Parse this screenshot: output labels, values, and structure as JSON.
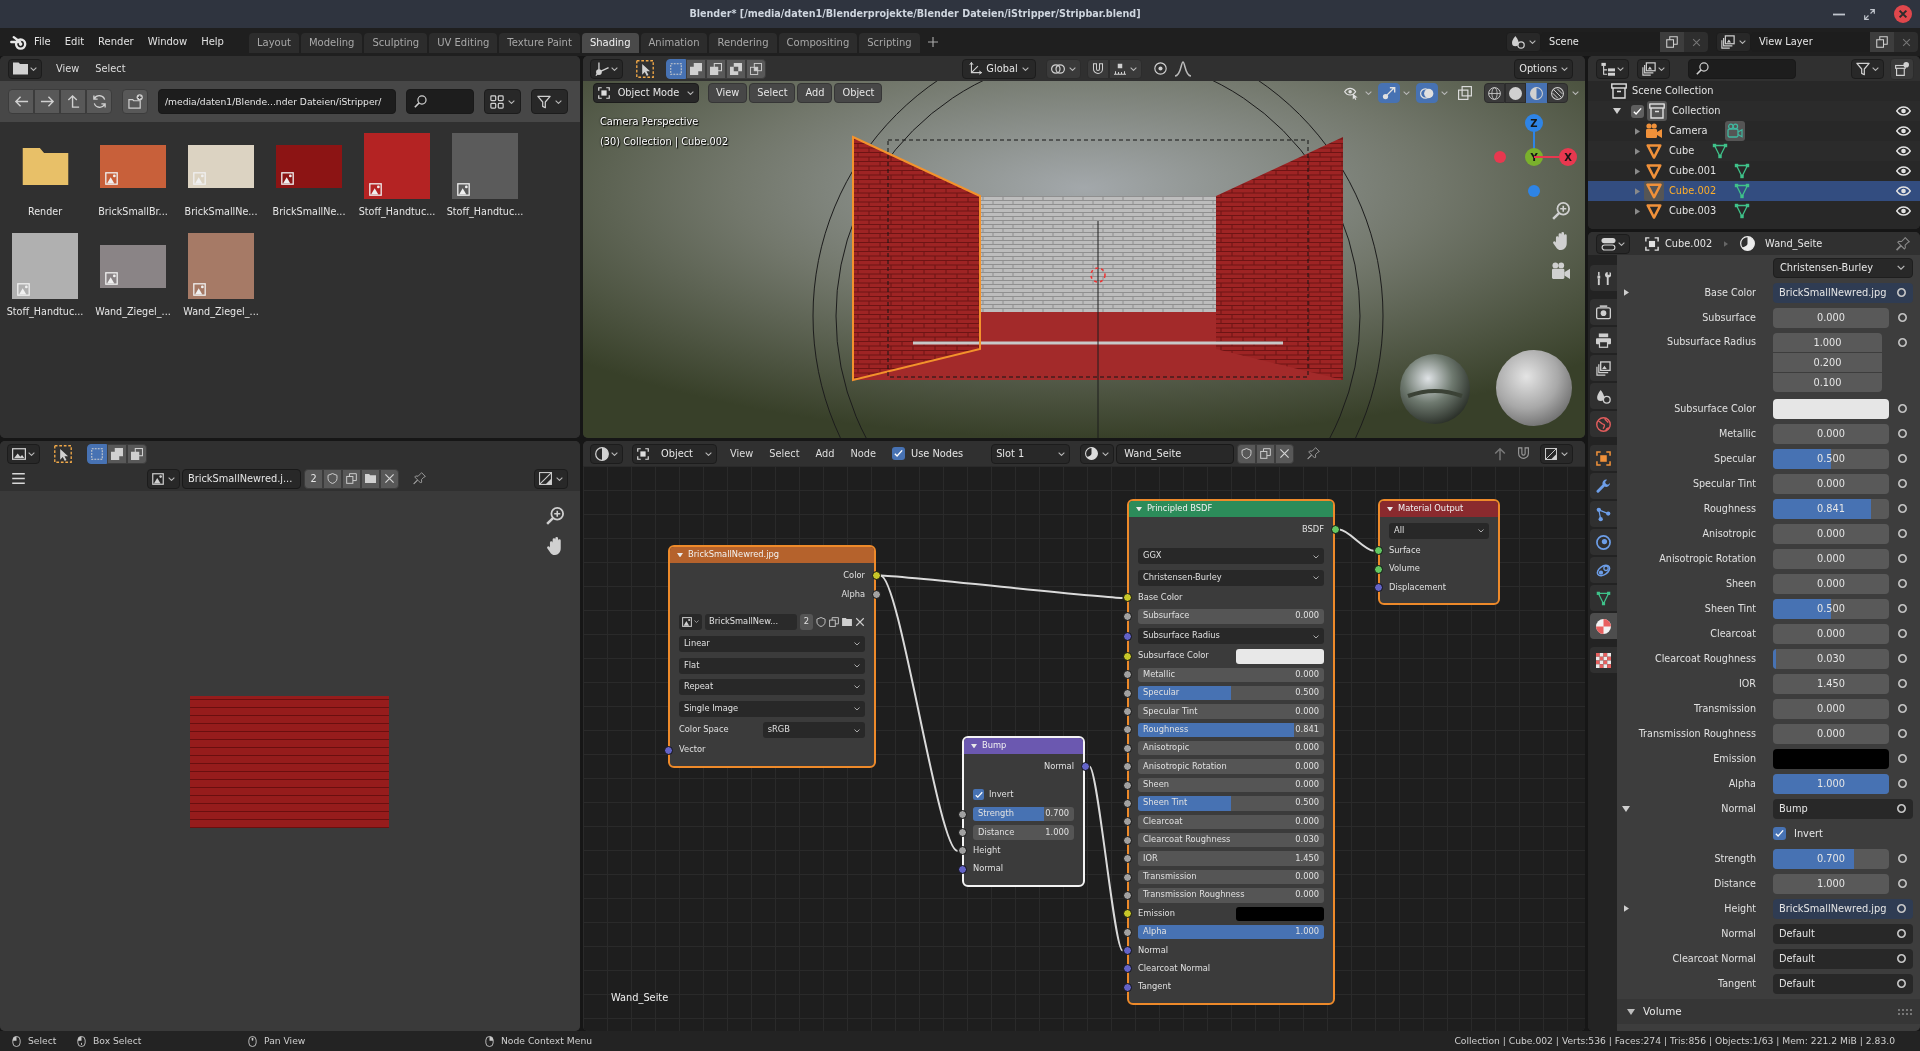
{
  "window": {
    "title": "Blender* [/media/daten1/Blenderprojekte/Blender Dateien/iStripper/Stripbar.blend]"
  },
  "menu": [
    "File",
    "Edit",
    "Render",
    "Window",
    "Help"
  ],
  "workspaces": [
    {
      "label": "Layout",
      "selected": false
    },
    {
      "label": "Modeling",
      "selected": false
    },
    {
      "label": "Sculpting",
      "selected": false
    },
    {
      "label": "UV Editing",
      "selected": false
    },
    {
      "label": "Texture Paint",
      "selected": false
    },
    {
      "label": "Shading",
      "selected": true
    },
    {
      "label": "Animation",
      "selected": false
    },
    {
      "label": "Rendering",
      "selected": false
    },
    {
      "label": "Compositing",
      "selected": false
    },
    {
      "label": "Scripting",
      "selected": false
    }
  ],
  "scene": "Scene",
  "view_layer": "View Layer",
  "file_browser": {
    "menu": [
      "View",
      "Select"
    ],
    "path": "/media/daten1/Blende...nder Dateien/iStripper/",
    "items": [
      {
        "name": "Render",
        "kind": "folder"
      },
      {
        "name": "BrickSmallBr...",
        "kind": "wide",
        "color": "#c8603a"
      },
      {
        "name": "BrickSmallNe...",
        "kind": "wide",
        "color": "#dcd3c2"
      },
      {
        "name": "BrickSmallNe...",
        "kind": "wide",
        "color": "#8c1414"
      },
      {
        "name": "Stoff_Handtuc...",
        "kind": "square",
        "color": "#b42323"
      },
      {
        "name": "Stoff_Handtuc...",
        "kind": "square",
        "color": "#5b5b5b"
      },
      {
        "name": "Stoff_Handtuc...",
        "kind": "square",
        "color": "#b0b0b0"
      },
      {
        "name": "Wand_Ziegel_...",
        "kind": "wide",
        "color": "#8a8486"
      },
      {
        "name": "Wand_Ziegel_...",
        "kind": "square",
        "color": "#a67a66"
      }
    ]
  },
  "viewport": {
    "select_modes": [
      {
        "kind": "set",
        "selected": true
      },
      {
        "kind": "extend",
        "selected": false
      },
      {
        "kind": "subtract",
        "selected": false
      },
      {
        "kind": "invert",
        "selected": false
      },
      {
        "kind": "intersect",
        "selected": false
      }
    ],
    "orientation": "Global",
    "options": "Options",
    "mode": "Object Mode",
    "menu": [
      "View",
      "Select",
      "Add",
      "Object"
    ],
    "toggles": [
      {
        "kind": "selectability",
        "on": false
      },
      {
        "kind": "gizmos",
        "on": true
      },
      {
        "kind": "overlays",
        "on": true
      },
      {
        "kind": "xray",
        "on": false
      }
    ],
    "shading": [
      {
        "kind": "wireframe",
        "selected": false
      },
      {
        "kind": "solid",
        "selected": false
      },
      {
        "kind": "material",
        "selected": true
      },
      {
        "kind": "rendered",
        "selected": false
      }
    ],
    "overlay_text": [
      "Camera Perspective",
      "(30) Collection | Cube.002"
    ],
    "axes": [
      {
        "label": "Z",
        "color": "#2e84e6"
      },
      {
        "label": "Y",
        "color": "#7ab02c"
      },
      {
        "label": "X",
        "color": "#e8384f"
      }
    ]
  },
  "image_editor": {
    "select_modes": [
      {
        "kind": "set",
        "selected": true
      },
      {
        "kind": "extend",
        "selected": false
      },
      {
        "kind": "subtract",
        "selected": false
      }
    ],
    "image": "BrickSmallNewred.j...",
    "users": "2"
  },
  "node_editor": {
    "object_type": "Object",
    "menu": [
      "View",
      "Select",
      "Add",
      "Node"
    ],
    "use_nodes": {
      "label": "Use Nodes",
      "checked": true
    },
    "slot": "Slot 1",
    "material": "Wand_Seite",
    "label": "Wand_Seite",
    "nodes": [
      {
        "title": "BrickSmallNewred.jpg",
        "kind": "texture",
        "selected": true,
        "active": false,
        "rows": [
          {
            "kind": "output",
            "label": "Color",
            "socket": {
              "color": "#c7c729"
            }
          },
          {
            "kind": "output",
            "label": "Alpha",
            "socket": {
              "color": "#a1a1a1"
            }
          },
          {
            "kind": "image",
            "value": "BrickSmallNew...",
            "users": "2"
          },
          {
            "kind": "dropdown",
            "value": "Linear"
          },
          {
            "kind": "dropdown",
            "value": "Flat"
          },
          {
            "kind": "dropdown",
            "value": "Repeat"
          },
          {
            "kind": "dropdown",
            "value": "Single Image"
          },
          {
            "kind": "dropdown",
            "label": "Color Space",
            "value": "sRGB"
          },
          {
            "kind": "input",
            "label": "Vector",
            "socket": {
              "color": "#6363c7"
            }
          }
        ]
      },
      {
        "title": "Bump",
        "kind": "vector",
        "selected": true,
        "active": true,
        "rows": [
          {
            "kind": "output",
            "label": "Normal",
            "socket": {
              "color": "#6363c7"
            }
          },
          {
            "kind": "checkbox",
            "label": "Invert",
            "checked": true
          },
          {
            "kind": "slider",
            "label": "Strength",
            "value": "0.700",
            "level": 0.7,
            "socket": {
              "color": "#a1a1a1"
            }
          },
          {
            "kind": "number",
            "label": "Distance",
            "value": "1.000",
            "socket": {
              "color": "#a1a1a1"
            }
          },
          {
            "kind": "input",
            "label": "Height",
            "socket": {
              "color": "#a1a1a1"
            }
          },
          {
            "kind": "input",
            "label": "Normal",
            "socket": {
              "color": "#6363c7"
            }
          }
        ]
      },
      {
        "title": "Principled BSDF",
        "kind": "shader",
        "selected": true,
        "active": false,
        "rows": [
          {
            "kind": "output",
            "label": "BSDF",
            "socket": {
              "color": "#63c763"
            }
          },
          {
            "kind": "dropdown",
            "value": "GGX"
          },
          {
            "kind": "dropdown",
            "value": "Christensen-Burley"
          },
          {
            "kind": "input",
            "label": "Base Color",
            "socket": {
              "color": "#c7c729"
            }
          },
          {
            "kind": "number",
            "label": "Subsurface",
            "value": "0.000",
            "socket": {
              "color": "#a1a1a1"
            }
          },
          {
            "kind": "dropdown",
            "value": "Subsurface Radius",
            "socket": {
              "color": "#6363c7"
            }
          },
          {
            "kind": "color",
            "label": "Subsurface Color",
            "color": "#e8e8e8",
            "socket": {
              "color": "#c7c729"
            }
          },
          {
            "kind": "number",
            "label": "Metallic",
            "value": "0.000",
            "socket": {
              "color": "#a1a1a1"
            }
          },
          {
            "kind": "slider",
            "label": "Specular",
            "value": "0.500",
            "level": 0.5,
            "socket": {
              "color": "#a1a1a1"
            }
          },
          {
            "kind": "number",
            "label": "Specular Tint",
            "value": "0.000",
            "socket": {
              "color": "#a1a1a1"
            }
          },
          {
            "kind": "slider",
            "label": "Roughness",
            "value": "0.841",
            "level": 0.841,
            "socket": {
              "color": "#a1a1a1"
            }
          },
          {
            "kind": "number",
            "label": "Anisotropic",
            "value": "0.000",
            "socket": {
              "color": "#a1a1a1"
            }
          },
          {
            "kind": "number",
            "label": "Anisotropic Rotation",
            "value": "0.000",
            "socket": {
              "color": "#a1a1a1"
            }
          },
          {
            "kind": "number",
            "label": "Sheen",
            "value": "0.000",
            "socket": {
              "color": "#a1a1a1"
            }
          },
          {
            "kind": "slider",
            "label": "Sheen Tint",
            "value": "0.500",
            "level": 0.5,
            "socket": {
              "color": "#a1a1a1"
            }
          },
          {
            "kind": "number",
            "label": "Clearcoat",
            "value": "0.000",
            "socket": {
              "color": "#a1a1a1"
            }
          },
          {
            "kind": "number",
            "label": "Clearcoat Roughness",
            "value": "0.030",
            "socket": {
              "color": "#a1a1a1"
            }
          },
          {
            "kind": "number",
            "label": "IOR",
            "value": "1.450",
            "socket": {
              "color": "#a1a1a1"
            }
          },
          {
            "kind": "number",
            "label": "Transmission",
            "value": "0.000",
            "socket": {
              "color": "#a1a1a1"
            }
          },
          {
            "kind": "number",
            "label": "Transmission Roughness",
            "value": "0.000",
            "socket": {
              "color": "#a1a1a1"
            }
          },
          {
            "kind": "color",
            "label": "Emission",
            "color": "#000000",
            "socket": {
              "color": "#c7c729"
            }
          },
          {
            "kind": "slider",
            "label": "Alpha",
            "value": "1.000",
            "level": 1,
            "socket": {
              "color": "#a1a1a1"
            }
          },
          {
            "kind": "input",
            "label": "Normal",
            "socket": {
              "color": "#6363c7"
            }
          },
          {
            "kind": "input",
            "label": "Clearcoat Normal",
            "socket": {
              "color": "#6363c7"
            }
          },
          {
            "kind": "input",
            "label": "Tangent",
            "socket": {
              "color": "#6363c7"
            }
          }
        ]
      },
      {
        "title": "Material Output",
        "kind": "output",
        "selected": true,
        "active": false,
        "rows": [
          {
            "kind": "dropdown",
            "value": "All"
          },
          {
            "kind": "input",
            "label": "Surface",
            "socket": {
              "color": "#63c763"
            }
          },
          {
            "kind": "input",
            "label": "Volume",
            "socket": {
              "color": "#63c763"
            }
          },
          {
            "kind": "input",
            "label": "Displacement",
            "socket": {
              "color": "#6363c7"
            }
          }
        ]
      }
    ]
  },
  "outliner": {
    "tree": [
      {
        "name": "Scene Collection",
        "kind": "scene",
        "selected": false,
        "children": [
          {
            "name": "Collection",
            "kind": "collection",
            "expanded": true,
            "checked": true,
            "selected": false,
            "active": true,
            "children": [
              {
                "name": "Camera",
                "kind": "camera",
                "expanded": false,
                "selected": false,
                "active": true
              },
              {
                "name": "Cube",
                "kind": "mesh",
                "expanded": false,
                "selected": false,
                "active": false
              },
              {
                "name": "Cube.001",
                "kind": "mesh",
                "expanded": false,
                "selected": false,
                "active": false
              },
              {
                "name": "Cube.002",
                "kind": "mesh",
                "expanded": false,
                "selected": true,
                "active": true
              },
              {
                "name": "Cube.003",
                "kind": "mesh",
                "expanded": false,
                "selected": false,
                "active": false
              }
            ]
          }
        ]
      }
    ]
  },
  "properties": {
    "tabs": [
      [
        {
          "kind": "tool",
          "selected": false
        }
      ],
      [
        {
          "kind": "render",
          "selected": false
        },
        {
          "kind": "output",
          "selected": false
        },
        {
          "kind": "view_layer",
          "selected": false
        },
        {
          "kind": "scene",
          "selected": false
        },
        {
          "kind": "world",
          "selected": false
        }
      ],
      [
        {
          "kind": "object",
          "selected": false
        },
        {
          "kind": "modifiers",
          "selected": false
        },
        {
          "kind": "particles",
          "selected": false
        },
        {
          "kind": "physics",
          "selected": false
        },
        {
          "kind": "constraints",
          "selected": false
        },
        {
          "kind": "data",
          "selected": false
        },
        {
          "kind": "material",
          "selected": true
        }
      ],
      [
        {
          "kind": "texture",
          "selected": false
        }
      ]
    ],
    "object": "Cube.002",
    "material": "Wand_Seite",
    "rows": [
      {
        "kind": "dropdown",
        "value": "Christensen-Burley"
      },
      {
        "kind": "image-link",
        "label": "Base Color",
        "value": "BrickSmallNewred.jpg",
        "expanded": false
      },
      {
        "kind": "number",
        "label": "Subsurface",
        "value": "0.000"
      },
      {
        "kind": "vector",
        "label": "Subsurface Radius",
        "values": [
          "1.000",
          "0.200",
          "0.100"
        ]
      },
      {
        "kind": "color",
        "label": "Subsurface Color",
        "color": "#e6e6e6"
      },
      {
        "kind": "number",
        "label": "Metallic",
        "value": "0.000"
      },
      {
        "kind": "slider",
        "label": "Specular",
        "value": "0.500",
        "level": 0.5
      },
      {
        "kind": "number",
        "label": "Specular Tint",
        "value": "0.000"
      },
      {
        "kind": "slider",
        "label": "Roughness",
        "value": "0.841",
        "level": 0.841
      },
      {
        "kind": "number",
        "label": "Anisotropic",
        "value": "0.000"
      },
      {
        "kind": "number",
        "label": "Anisotropic Rotation",
        "value": "0.000"
      },
      {
        "kind": "number",
        "label": "Sheen",
        "value": "0.000"
      },
      {
        "kind": "slider",
        "label": "Sheen Tint",
        "value": "0.500",
        "level": 0.5
      },
      {
        "kind": "number",
        "label": "Clearcoat",
        "value": "0.000"
      },
      {
        "kind": "slider",
        "label": "Clearcoat Roughness",
        "value": "0.030",
        "level": 0.03
      },
      {
        "kind": "number",
        "label": "IOR",
        "value": "1.450"
      },
      {
        "kind": "number",
        "label": "Transmission",
        "value": "0.000"
      },
      {
        "kind": "number",
        "label": "Transmission Roughness",
        "value": "0.000"
      },
      {
        "kind": "color",
        "label": "Emission",
        "color": "#000000"
      },
      {
        "kind": "slider",
        "label": "Alpha",
        "value": "1.000",
        "level": 1
      },
      {
        "kind": "node-link",
        "label": "Normal",
        "value": "Bump",
        "expanded": true,
        "children": [
          {
            "kind": "checkbox",
            "label": "Invert",
            "checked": true
          },
          {
            "kind": "slider",
            "label": "Strength",
            "value": "0.700",
            "level": 0.7
          },
          {
            "kind": "number",
            "label": "Distance",
            "value": "1.000"
          },
          {
            "kind": "image-link",
            "label": "Height",
            "value": "BrickSmallNewred.jpg",
            "expanded": false
          },
          {
            "kind": "node-link",
            "label": "Normal",
            "value": "Default"
          }
        ]
      },
      {
        "kind": "node-link",
        "label": "Clearcoat Normal",
        "value": "Default"
      },
      {
        "kind": "node-link",
        "label": "Tangent",
        "value": "Default"
      }
    ],
    "section": {
      "label": "Volume",
      "expanded": true
    }
  },
  "status_bar": {
    "hints": [
      {
        "kind": "left",
        "label": "Select"
      },
      {
        "kind": "drag",
        "label": "Box Select"
      },
      {
        "kind": "middle",
        "label": "Pan View"
      },
      {
        "kind": "right",
        "label": "Node Context Menu"
      }
    ],
    "stats": "Collection | Cube.002 | Verts:536 | Faces:274 | Tris:856 | Objects:1/63 | Mem: 221.2 MiB | 2.83.0"
  }
}
